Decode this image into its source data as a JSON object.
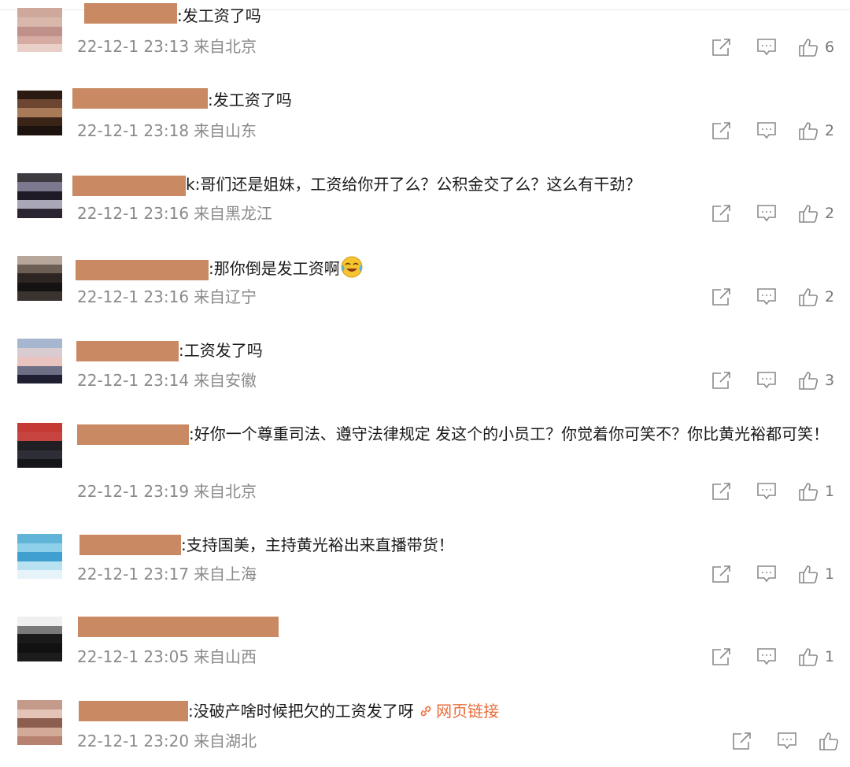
{
  "comments": [
    {
      "text": ":发工资了吗",
      "time": "22-12-1 23:13",
      "location": "来自北京",
      "likes": "6",
      "avatar_colors": [
        "#cfa89c",
        "#d9b7ab",
        "#c0908a",
        "#d6aba2",
        "#e8cfc7"
      ]
    },
    {
      "text": ":发工资了吗",
      "time": "22-12-1 23:18",
      "location": "来自山东",
      "likes": "2",
      "avatar_colors": [
        "#2b1a12",
        "#6c4630",
        "#a97a58",
        "#3a2418",
        "#1c130e"
      ]
    },
    {
      "text": ":哥们还是姐妹，工资给你开了么？公积金交了么？这么有干劲？",
      "text_prefix": "k",
      "time": "22-12-1 23:16",
      "location": "来自黑龙江",
      "likes": "2",
      "avatar_colors": [
        "#3d3a40",
        "#7b7890",
        "#1e1a26",
        "#a9a6b8",
        "#2c2430"
      ]
    },
    {
      "text": ":那你倒是发工资啊",
      "time": "22-12-1 23:16",
      "location": "来自辽宁",
      "likes": "2",
      "avatar_colors": [
        "#b6a79a",
        "#6e5f55",
        "#2c2522",
        "#151212",
        "#3a3330"
      ]
    },
    {
      "text": ":工资发了吗",
      "time": "22-12-1 23:14",
      "location": "来自安徽",
      "likes": "3",
      "avatar_colors": [
        "#a7b6cf",
        "#d8ccd0",
        "#e8c3c0",
        "#6d6f86",
        "#1e2032"
      ]
    },
    {
      "text": ":好你一个尊重司法、遵守法律规定  发这个的小员工？你觉着你可笑不？你比黄光裕都可笑！",
      "time": "22-12-1 23:19",
      "location": "来自北京",
      "likes": "1",
      "avatar_colors": [
        "#c63a36",
        "#c84441",
        "#1f1f24",
        "#2e2f36",
        "#15161a"
      ]
    },
    {
      "text": ":支持国美，主持黄光裕出来直播带货！",
      "time": "22-12-1 23:17",
      "location": "来自上海",
      "likes": "1",
      "avatar_colors": [
        "#5fb4d8",
        "#8ed0ea",
        "#3fa0cf",
        "#b8e2f2",
        "#e6f4fa"
      ]
    },
    {
      "text": "",
      "time": "22-12-1 23:05",
      "location": "来自山西",
      "likes": "1",
      "avatar_colors": [
        "#efefef",
        "#7a7a7a",
        "#1a1a1a",
        "#111111",
        "#1c1c1c"
      ]
    },
    {
      "text": ":没破产啥时候把欠的工资发了呀",
      "link": "网页链接",
      "time": "22-12-1 23:20",
      "location": "来自湖北",
      "likes": "",
      "avatar_colors": [
        "#c49a8a",
        "#e3c4b6",
        "#8c5e4f",
        "#d3aa98",
        "#b78270"
      ]
    }
  ],
  "icons": {
    "share": "share-icon",
    "reply": "comment-icon",
    "like": "thumbs-up-icon",
    "link": "link-icon",
    "emoji": "crying-laughing-emoji"
  }
}
